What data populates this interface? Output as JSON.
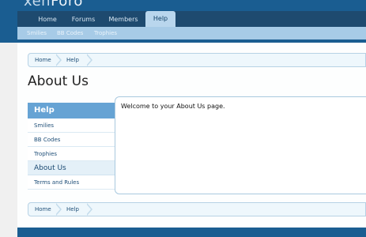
{
  "header": {
    "logo_light": "xen",
    "logo_bold": "Foro",
    "tabs": [
      {
        "label": "Home"
      },
      {
        "label": "Forums"
      },
      {
        "label": "Members"
      },
      {
        "label": "Help"
      }
    ],
    "selected_tab": "Help",
    "subnav": [
      {
        "label": "Smilies"
      },
      {
        "label": "BB Codes"
      },
      {
        "label": "Trophies"
      }
    ]
  },
  "breadcrumb_top": [
    {
      "label": "Home"
    },
    {
      "label": "Help"
    }
  ],
  "page_title": "About Us",
  "sidebar": {
    "heading": "Help",
    "items": [
      {
        "label": "Smilies"
      },
      {
        "label": "BB Codes"
      },
      {
        "label": "Trophies"
      }
    ],
    "section": "About Us",
    "extra_items": [
      {
        "label": "Terms and Rules"
      }
    ]
  },
  "main": {
    "welcome_text": "Welcome to your About Us page."
  },
  "breadcrumb_bottom": [
    {
      "label": "Home"
    },
    {
      "label": "Help"
    }
  ],
  "colors": {
    "header_bg": "#1a5d91",
    "nav_bg": "#1e4a6f",
    "subnav_bg": "#a7cbe7",
    "sidebar_head": "#66a3d4",
    "link": "#1f4f78"
  }
}
